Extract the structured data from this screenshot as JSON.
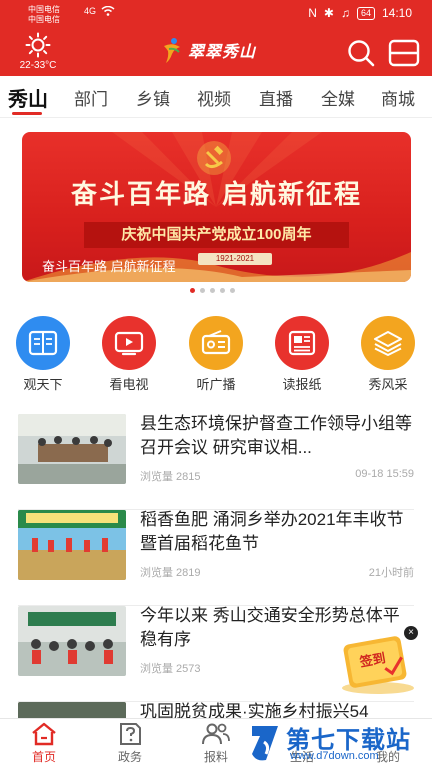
{
  "status_bar": {
    "carrier1": "中国电信",
    "carrier2": "中国电信",
    "network": "4G",
    "battery": "64",
    "time": "14:10"
  },
  "header": {
    "weather_icon": "sun-icon",
    "temperature": "22-33°C",
    "logo_text": "翠翠秀山"
  },
  "tabs": [
    {
      "label": "秀山",
      "active": true
    },
    {
      "label": "部门"
    },
    {
      "label": "乡镇"
    },
    {
      "label": "视频"
    },
    {
      "label": "直播"
    },
    {
      "label": "全媒"
    },
    {
      "label": "商城"
    }
  ],
  "banner": {
    "headline": "奋斗百年路 启航新征程",
    "ribbon": "庆祝中国共产党成立100周年",
    "years": "1921-2021",
    "caption": "奋斗百年路 启航新征程",
    "slide_count": 5,
    "active_slide": 1
  },
  "quick_entries": [
    {
      "label": "观天下",
      "icon": "book-icon",
      "color": "#2f8cf0"
    },
    {
      "label": "看电视",
      "icon": "tv-icon",
      "color": "#e8322d"
    },
    {
      "label": "听广播",
      "icon": "radio-icon",
      "color": "#f3a51f"
    },
    {
      "label": "读报纸",
      "icon": "newspaper-icon",
      "color": "#e8322d"
    },
    {
      "label": "秀风采",
      "icon": "layers-icon",
      "color": "#f3a51f"
    }
  ],
  "news": [
    {
      "title": "县生态环境保护督查工作领导小组等召开会议 研究审议相...",
      "views": "浏览量 2815",
      "time": "09-18 15:59"
    },
    {
      "title": "稻香鱼肥 涌洞乡举办2021年丰收节暨首届稻花鱼节",
      "views": "浏览量 2819",
      "time": "21小时前"
    },
    {
      "title": "今年以来 秀山交通安全形势总体平稳有序",
      "views": "浏览量 2573",
      "time": ""
    },
    {
      "title": "巩固脱贫成果·实施乡村振兴54",
      "views": "",
      "time": ""
    }
  ],
  "signin": {
    "label": "签到"
  },
  "bottom_nav": [
    {
      "label": "首页",
      "icon": "home-icon",
      "active": true
    },
    {
      "label": "政务",
      "icon": "question-doc-icon"
    },
    {
      "label": "报料",
      "icon": "users-icon"
    },
    {
      "label": "生活",
      "icon": "life-icon"
    },
    {
      "label": "我的",
      "icon": "user-icon"
    }
  ],
  "watermark": {
    "text": "第七下载站",
    "url": "www.d7down.com"
  },
  "colors": {
    "brand": "#e12b25",
    "blue": "#2f8cf0",
    "orange": "#f3a51f"
  }
}
